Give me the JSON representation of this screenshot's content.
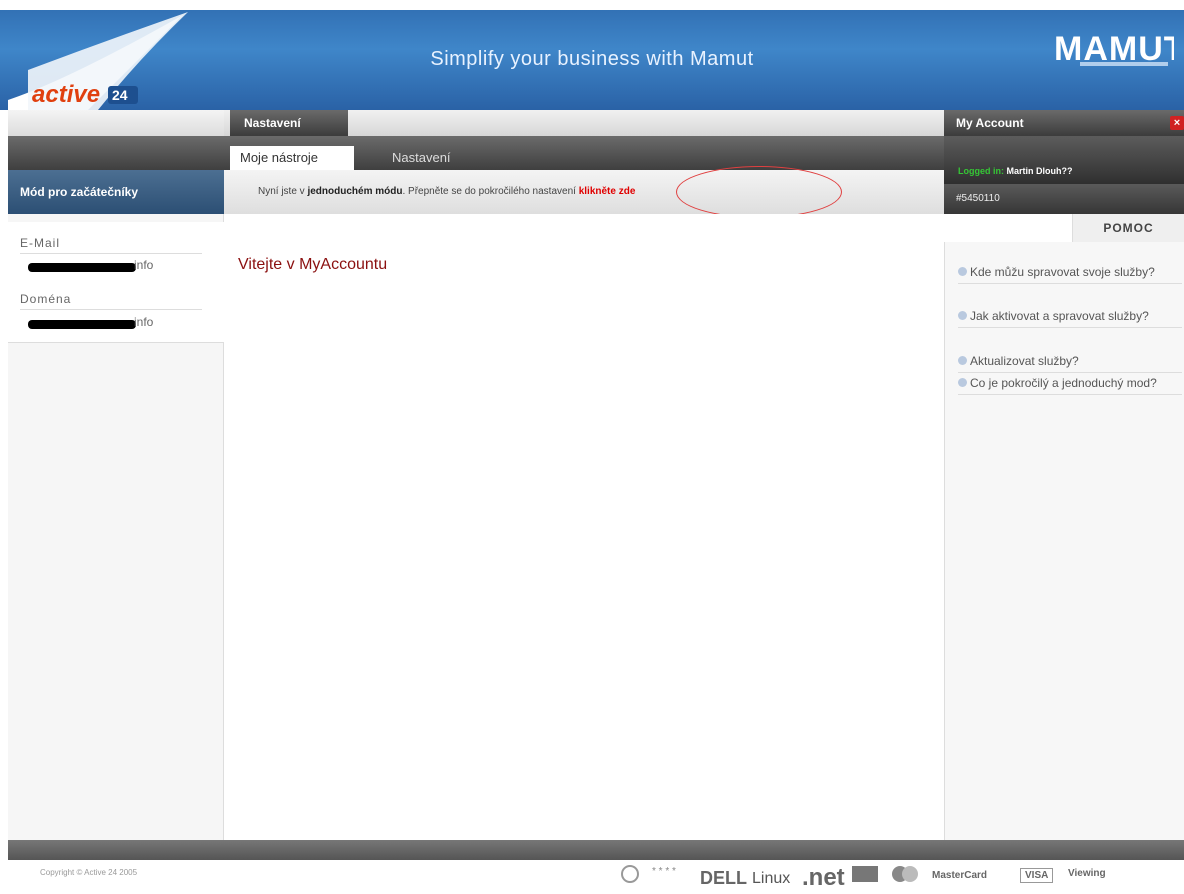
{
  "header": {
    "logo_text": "active",
    "logo_num": "24",
    "tagline": "Simplify your business with Mamut",
    "brand_logo": "MAMUT"
  },
  "top_tabs": {
    "active_label": "Nastavení"
  },
  "sub_tabs": [
    {
      "label": "Moje nástroje"
    },
    {
      "label": "Nastavení"
    }
  ],
  "sidebar": {
    "mode_title": "Mód pro začátečníky",
    "email_label": "E-Mail",
    "email_value_suffix": "info",
    "domain_label": "Doména",
    "domain_value_suffix": "info"
  },
  "mode_bar": {
    "prefix": "Nyní jste v ",
    "mode_bold": "jednoduchém módu",
    "middle": ". Přepněte se do pokročilého nastavení ",
    "link": "klikněte zde"
  },
  "main": {
    "welcome": "Vitejte v MyAccountu"
  },
  "account": {
    "title": "My Account",
    "close_icon": "close-icon",
    "logged_label": "Logged in:",
    "user_name": "Martin Dlouh??",
    "account_id": "#5450110"
  },
  "help": {
    "tab_label": "POMOC",
    "items": [
      {
        "label": "Kde můžu spravovat svoje služby?"
      },
      {
        "label": "Jak aktivovat a spravovat služby?"
      },
      {
        "label": "Aktualizovat služby?"
      },
      {
        "label": "Co je pokročilý a jednoduchý mod?"
      }
    ]
  },
  "footer": {
    "copyright": "Copyright © Active 24 2005",
    "partners": [
      "DELL",
      "Linux",
      ".net",
      "MasterCard",
      "VISA",
      "Viewing"
    ]
  },
  "colors": {
    "header_blue": "#3f86c9",
    "link_red": "#e00000",
    "welcome_red": "#8b1010",
    "logged_green": "#35c635"
  }
}
